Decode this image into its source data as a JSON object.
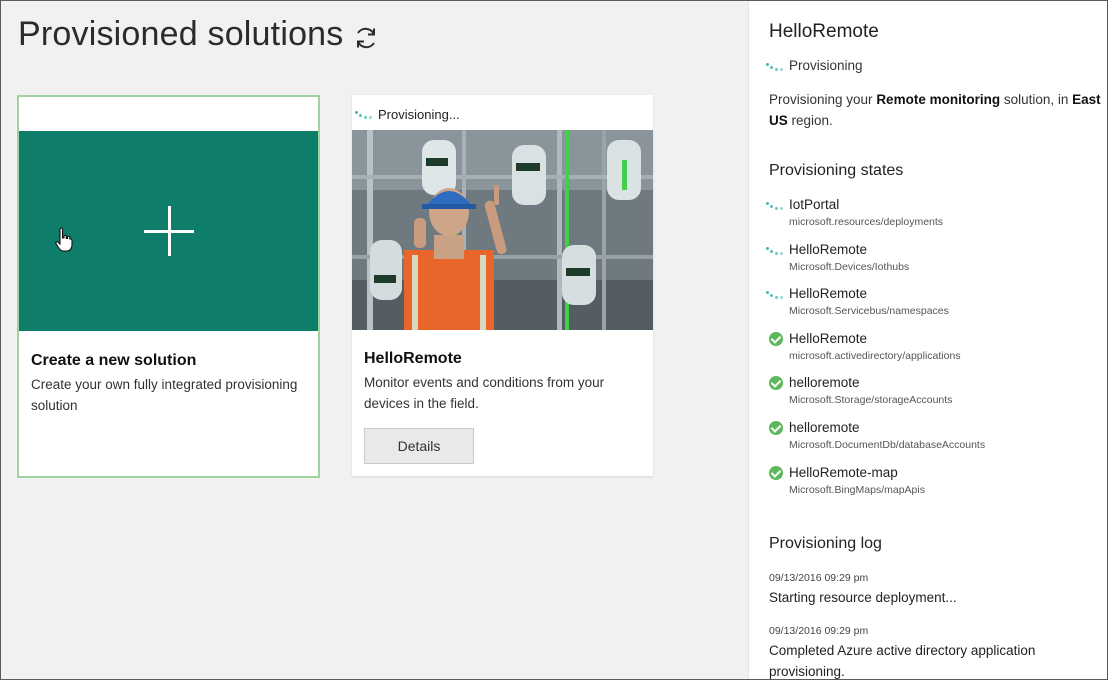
{
  "page": {
    "title": "Provisioned solutions",
    "refresh_icon": "refresh-icon"
  },
  "cards": {
    "new_solution": {
      "title": "Create a new solution",
      "description": "Create your own fully integrated provisioning solution",
      "tile_color": "#0e7e6a",
      "icon": "plus-icon"
    },
    "existing": {
      "status": "Provisioning...",
      "title": "HelloRemote",
      "description": "Monitor events and conditions from your devices in the field.",
      "details_label": "Details",
      "image": "industrial-engineer-photo"
    }
  },
  "panel": {
    "title": "HelloRemote",
    "status": "Provisioning",
    "description": {
      "prefix": "Provisioning your ",
      "solution_type": "Remote monitoring",
      "middle": " solution, in ",
      "region": "East US",
      "suffix": " region."
    },
    "states_heading": "Provisioning states",
    "states": [
      {
        "name": "IotPortal",
        "type": "microsoft.resources/deployments",
        "state": "in-progress"
      },
      {
        "name": "HelloRemote",
        "type": "Microsoft.Devices/Iothubs",
        "state": "in-progress"
      },
      {
        "name": "HelloRemote",
        "type": "Microsoft.Servicebus/namespaces",
        "state": "in-progress"
      },
      {
        "name": "HelloRemote",
        "type": "microsoft.activedirectory/applications",
        "state": "done"
      },
      {
        "name": "helloremote",
        "type": "Microsoft.Storage/storageAccounts",
        "state": "done"
      },
      {
        "name": "helloremote",
        "type": "Microsoft.DocumentDb/databaseAccounts",
        "state": "done"
      },
      {
        "name": "HelloRemote-map",
        "type": "Microsoft.BingMaps/mapApis",
        "state": "done"
      }
    ],
    "log_heading": "Provisioning log",
    "log": [
      {
        "timestamp": "09/13/2016 09:29 pm",
        "message": "Starting resource deployment..."
      },
      {
        "timestamp": "09/13/2016 09:29 pm",
        "message": "Completed Azure active directory application provisioning."
      }
    ]
  },
  "colors": {
    "accent_green": "#0e7e6a",
    "progress_teal": "#2bb3a8",
    "success_green": "#5cb85c",
    "selected_border": "#9fd39f"
  }
}
